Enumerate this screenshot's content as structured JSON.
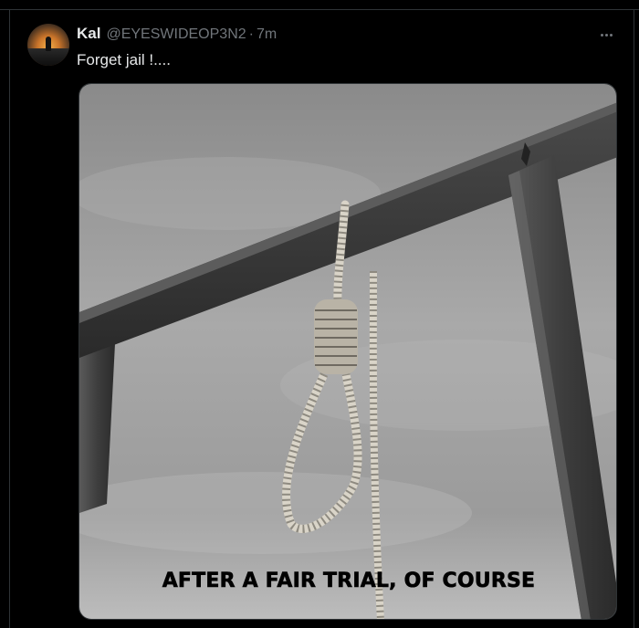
{
  "tweet": {
    "author_name": "Kal",
    "handle": "@EYESWIDEOP3N2",
    "separator": "·",
    "time": "7m",
    "text": "Forget jail !....",
    "avatar_icon": "sunset-silhouette-avatar",
    "more_icon": "ellipsis-icon"
  },
  "media": {
    "caption": "AFTER A FAIR TRIAL, OF COURSE",
    "description_icon": "gallows-noose-image"
  },
  "colors": {
    "background": "#000000",
    "primary_text": "#e7e9ea",
    "secondary_text": "#71767b",
    "border": "#2f3336"
  }
}
